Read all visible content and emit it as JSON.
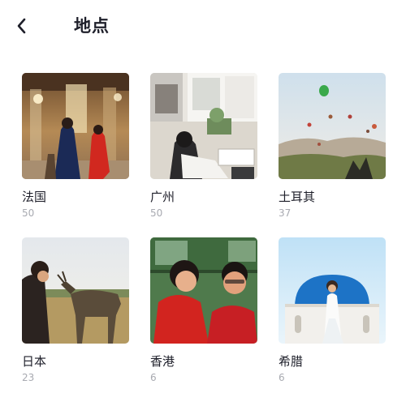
{
  "header": {
    "back_icon": "chevron-left-icon",
    "title": "地点"
  },
  "places": [
    {
      "name": "法国",
      "count": "50",
      "photo": "people-in-grand-hall"
    },
    {
      "name": "广州",
      "count": "50",
      "photo": "person-reading-at-desk"
    },
    {
      "name": "土耳其",
      "count": "37",
      "photo": "hot-air-balloons-valley"
    },
    {
      "name": "日本",
      "count": "23",
      "photo": "person-with-deer"
    },
    {
      "name": "香港",
      "count": "6",
      "photo": "couple-selfie-tram"
    },
    {
      "name": "希腊",
      "count": "6",
      "photo": "woman-blue-dome-church"
    }
  ],
  "colors": {
    "text": "#1e1f2a",
    "secondary": "#a8aab1",
    "background": "#ffffff"
  }
}
